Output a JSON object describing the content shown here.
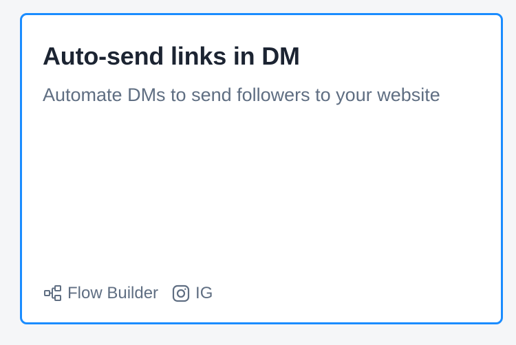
{
  "card": {
    "title": "Auto-send links in DM",
    "description": "Automate DMs to send followers to your website",
    "border_color": "#1a8cff",
    "tags": [
      {
        "icon": "flow-builder-icon",
        "label": "Flow Builder"
      },
      {
        "icon": "instagram-icon",
        "label": "IG"
      }
    ]
  }
}
